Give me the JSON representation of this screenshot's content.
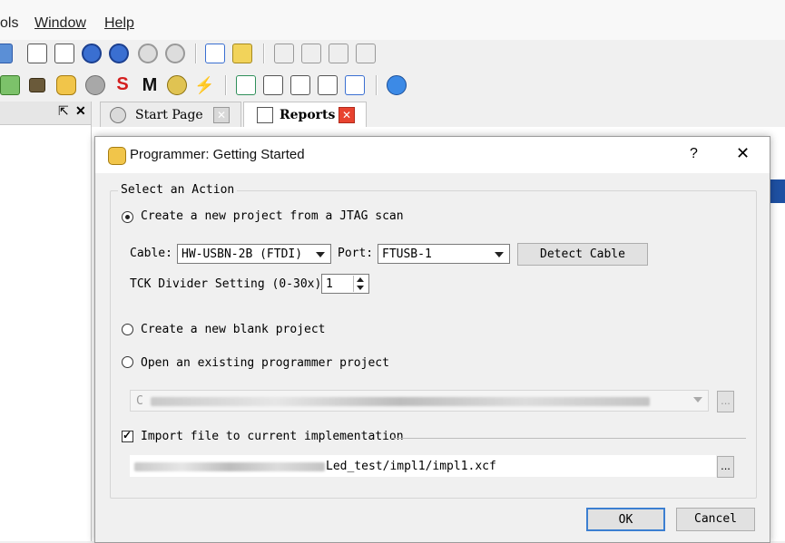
{
  "menu": {
    "tools": "ols",
    "window": "Window",
    "help": "Help"
  },
  "tabs": [
    {
      "label": "Start Page"
    },
    {
      "label": "Reports"
    }
  ],
  "leftpane": {
    "pin": "⇱",
    "close": "✕"
  },
  "dialog": {
    "title": "Programmer: Getting Started",
    "help": "?",
    "close": "✕",
    "group_title": "Select an Action",
    "option_jtag": "Create a new project from a JTAG scan",
    "cable_label": "Cable:",
    "cable_value": "HW-USBN-2B (FTDI)",
    "port_label": "Port:",
    "port_value": "FTUSB-1",
    "detect_cable": "Detect Cable",
    "tck_label": "TCK Divider Setting (0-30x):",
    "tck_value": "1",
    "option_blank": "Create a new blank project",
    "option_open": "Open an existing programmer project",
    "open_path_prefix": "C",
    "browse": "...",
    "import_label": "Import file to current implementation",
    "import_path_suffix": "Led_test/impl1/impl1.xcf",
    "ok": "OK",
    "cancel": "Cancel"
  },
  "colors": {
    "accent": "#1e50a2",
    "close_red": "#e8432f"
  }
}
